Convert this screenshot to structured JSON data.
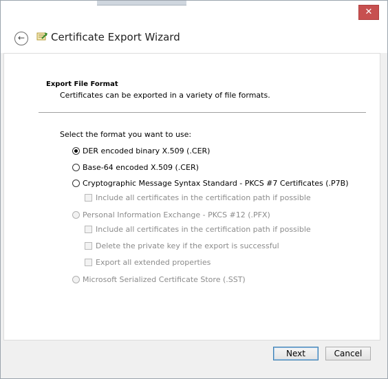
{
  "window": {
    "title": "Certificate Export Wizard",
    "close_symbol": "✕"
  },
  "nav": {
    "back_symbol": "←"
  },
  "section": {
    "heading": "Export File Format",
    "description": "Certificates can be exported in a variety of file formats."
  },
  "form": {
    "prompt": "Select the format you want to use:",
    "options": [
      {
        "label": "DER encoded binary X.509 (.CER)",
        "selected": true,
        "enabled": true
      },
      {
        "label": "Base-64 encoded X.509 (.CER)",
        "selected": false,
        "enabled": true
      },
      {
        "label": "Cryptographic Message Syntax Standard - PKCS #7 Certificates (.P7B)",
        "selected": false,
        "enabled": true
      },
      {
        "label": "Personal Information Exchange - PKCS #12 (.PFX)",
        "selected": false,
        "enabled": false
      },
      {
        "label": "Microsoft Serialized Certificate Store (.SST)",
        "selected": false,
        "enabled": false
      }
    ],
    "checkboxes": [
      {
        "label": "Include all certificates in the certification path if possible",
        "checked": false,
        "enabled": false
      },
      {
        "label": "Include all certificates in the certification path if possible",
        "checked": false,
        "enabled": false
      },
      {
        "label": "Delete the private key if the export is successful",
        "checked": false,
        "enabled": false
      },
      {
        "label": "Export all extended properties",
        "checked": false,
        "enabled": false
      }
    ]
  },
  "buttons": {
    "next": "Next",
    "cancel": "Cancel"
  },
  "colors": {
    "close_button": "#c75050",
    "default_button_border": "#3c7fb1",
    "disabled_text": "#8b8b8b"
  }
}
